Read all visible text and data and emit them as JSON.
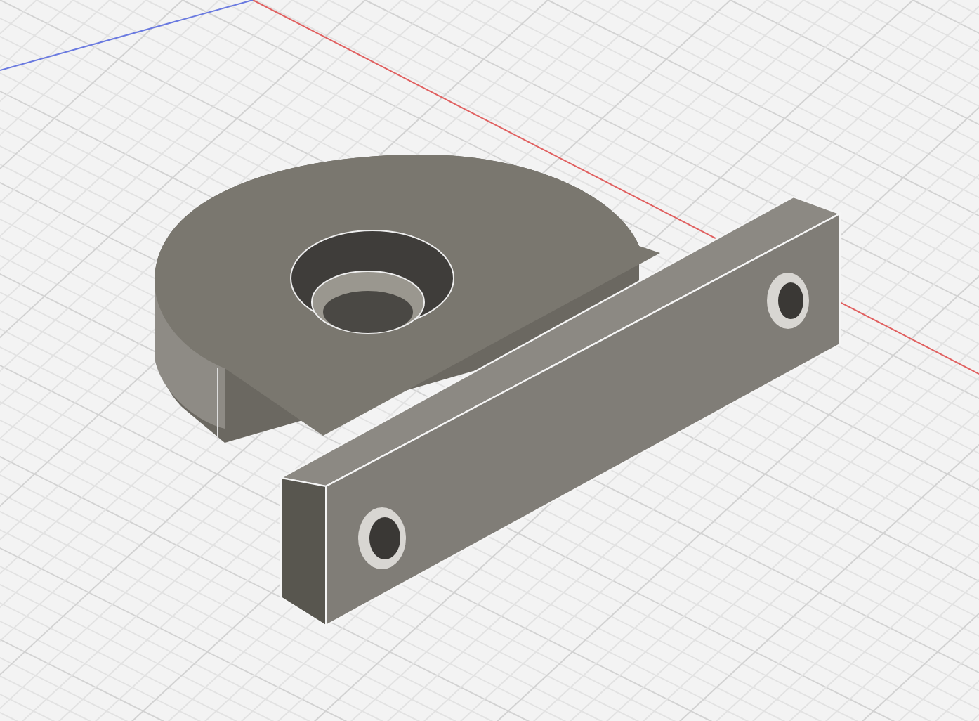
{
  "viewport": {
    "kind": "model",
    "grid": true,
    "axes": true
  }
}
